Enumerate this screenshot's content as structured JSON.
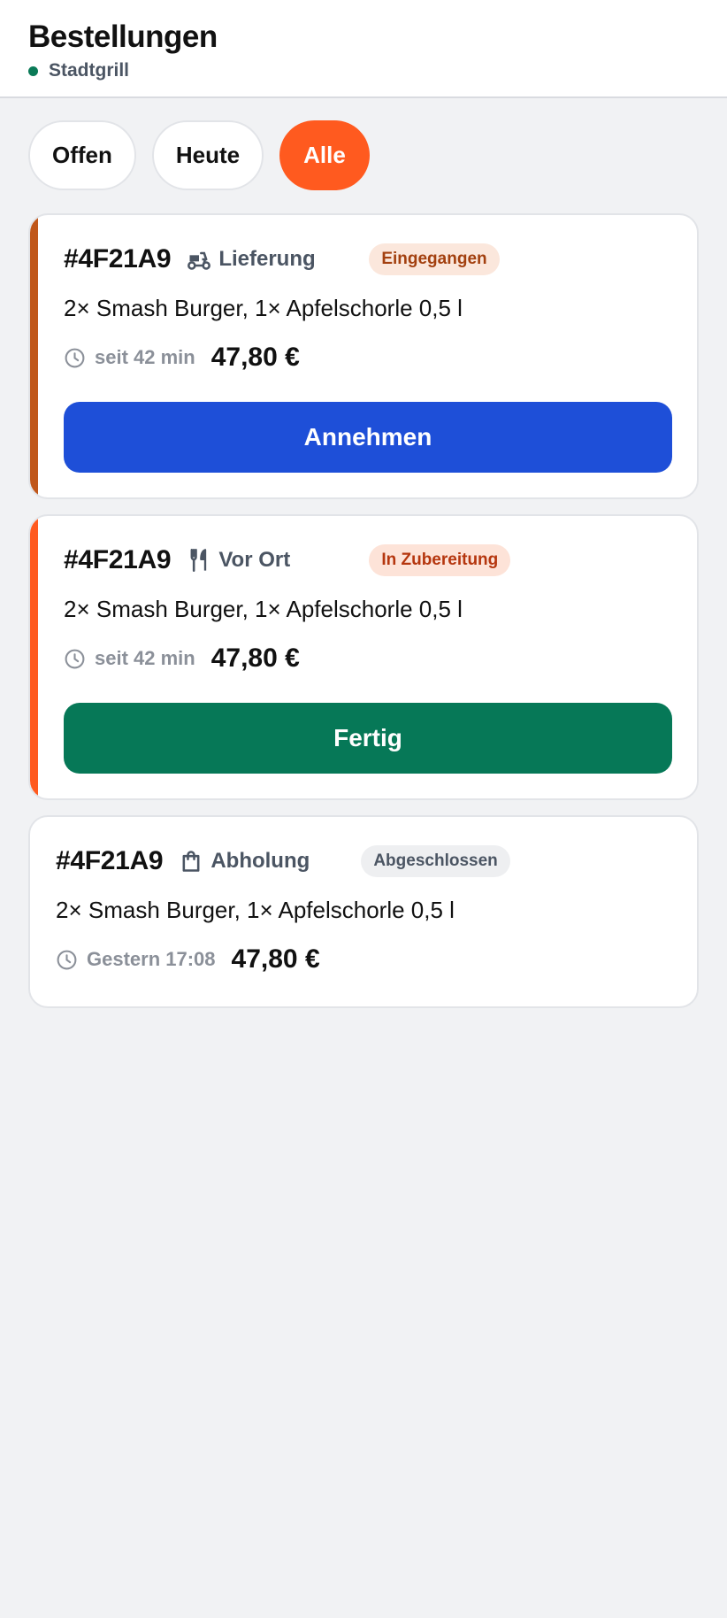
{
  "header": {
    "title": "Bestellungen",
    "restaurant": "Stadtgrill",
    "status_dot_color": "#0a7a57"
  },
  "filters": [
    {
      "label": "Offen",
      "active": false
    },
    {
      "label": "Heute",
      "active": false
    },
    {
      "label": "Alle",
      "active": true
    }
  ],
  "colors": {
    "accent": "#ff5a1f",
    "accept_button": "#1e4fd8",
    "done_button": "#067857",
    "stripe_received": "#c0571a",
    "stripe_preparing": "#ff5a1f"
  },
  "orders": [
    {
      "id": "#4F21A9",
      "mode": "Lieferung",
      "mode_icon": "scooter-icon",
      "status": "Eingegangen",
      "status_bg": "#fbe7dc",
      "status_color": "#a3400f",
      "items": "2× Smash Burger, 1× Apfelschorle 0,5 l",
      "time": "seit 42 min",
      "price": "47,80 €",
      "action": "Annehmen"
    },
    {
      "id": "#4F21A9",
      "mode": "Vor Ort",
      "mode_icon": "fork-knife-icon",
      "status": "In Zubereitung",
      "status_bg": "#fde3d8",
      "status_color": "#b5360e",
      "items": "2× Smash Burger, 1× Apfelschorle 0,5 l",
      "time": "seit 42 min",
      "price": "47,80 €",
      "action": "Fertig"
    },
    {
      "id": "#4F21A9",
      "mode": "Abholung",
      "mode_icon": "shopping-bag-icon",
      "status": "Abgeschlossen",
      "status_bg": "#eeeff1",
      "status_color": "#4b5563",
      "items": "2× Smash Burger, 1× Apfelschorle 0,5 l",
      "time": "Gestern 17:08",
      "price": "47,80 €"
    }
  ]
}
